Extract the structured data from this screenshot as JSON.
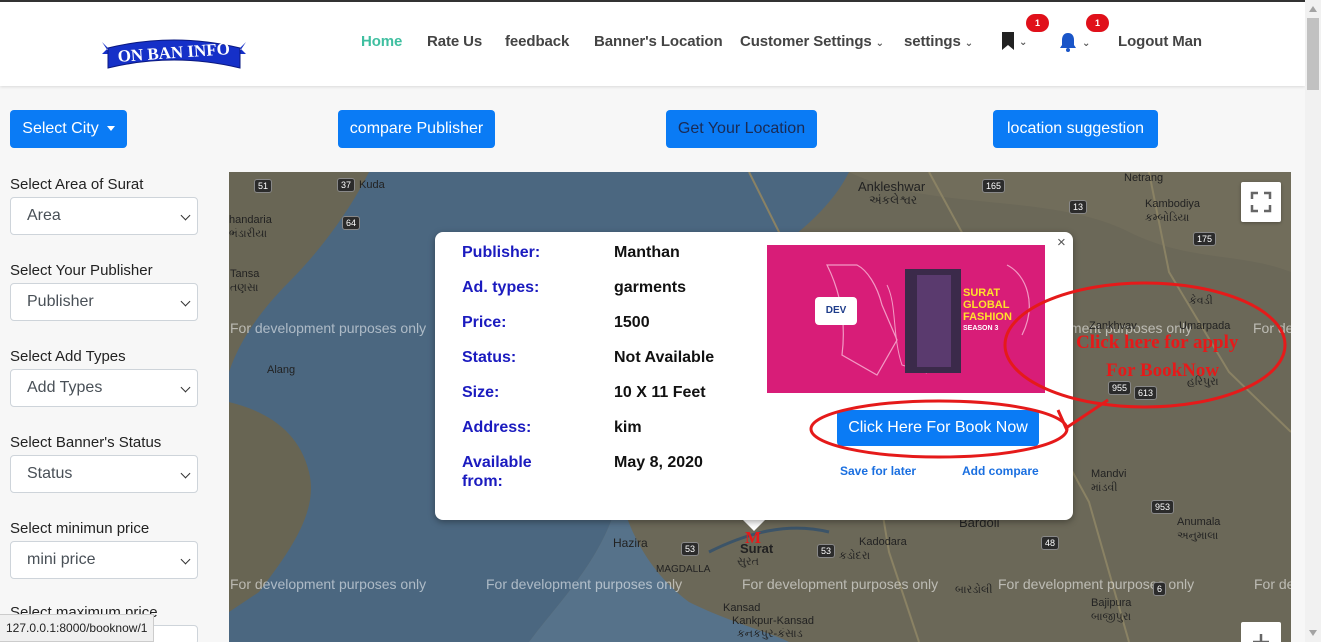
{
  "brand": {
    "logo_text": "ON BAN INFO"
  },
  "nav": {
    "home": "Home",
    "rate_us": "Rate Us",
    "feedback": "feedback",
    "banners_location": "Banner's Location",
    "customer_settings": "Customer Settings",
    "settings": "settings",
    "bookmark_count": "1",
    "notification_count": "1",
    "logout": "Logout Man"
  },
  "actions": {
    "select_city": "Select City",
    "compare_publisher": "compare Publisher",
    "get_location": "Get Your Location",
    "location_suggestion": "location suggestion"
  },
  "sidebar": {
    "area_label": "Select Area of Surat",
    "area_value": "Area",
    "publisher_label": "Select Your Publisher",
    "publisher_value": "Publisher",
    "add_types_label": "Select Add Types",
    "add_types_value": "Add Types",
    "status_label": "Select Banner's Status",
    "status_value": "Status",
    "min_price_label": "Select minimun price",
    "min_price_value": "mini price",
    "max_price_label": "Select maximum price"
  },
  "map": {
    "watermark": "For development purposes only",
    "places": {
      "ankleshwar": "Ankleshwar",
      "ankleshwar_gu": "અંકલેશ્વર",
      "kuda": "Kuda",
      "netrang": "Netrang",
      "kambodiya": "Kambodiya",
      "kambodiya_gu": "કમ્બોડિયા",
      "handaria": "handaria",
      "handaria_gu": "ભંડારીયા",
      "tansa": "Tansa",
      "tansa_gu": "તણસા",
      "alang": "Alang",
      "zankhvav": "Zankhvav",
      "umarpada": "Umarpada",
      "kevdi": "કેવડી",
      "haripura": "હરિપુરા",
      "mandvi": "Mandvi",
      "mandvi_gu": "માંડવી",
      "anumala": "Anumala",
      "anumala_gu": "અનુમાલા",
      "hazira": "Hazira",
      "surat": "Surat",
      "surat_gu": "સુરત",
      "kadodara": "Kadodara",
      "kadodara_gu": "કડોદરા",
      "magdalla": "MAGDALLA",
      "bardoli": "Bardoli",
      "bardoli_gu": "બારડોલી",
      "kansad": "Kansad",
      "kankpur": "Kankpur-Kansad",
      "kankpur_gu": "કનકપુર-કંસાડ",
      "bajipura": "Bajipura",
      "bajipura_gu": "બાજીપુરા"
    },
    "roads": [
      "37",
      "51",
      "165",
      "13",
      "175",
      "64",
      "955",
      "613",
      "53",
      "953",
      "48",
      "6",
      "53"
    ]
  },
  "popup": {
    "publisher_key": "Publisher:",
    "publisher_val": "Manthan",
    "adtypes_key": "Ad. types:",
    "adtypes_val": "garments",
    "price_key": "Price:",
    "price_val": "1500",
    "status_key": "Status:",
    "status_val": "Not Available",
    "size_key": "Size:",
    "size_val": "10 X 11 Feet",
    "address_key": "Address:",
    "address_val": "kim",
    "available_key_1": "Available",
    "available_key_2": "from:",
    "available_val": "May 8, 2020",
    "book_now": "Click Here For Book Now",
    "save_later": "Save for later",
    "add_compare": "Add compare",
    "close": "×",
    "ad": {
      "brand": "DEV",
      "title_1": "SURAT",
      "title_2": "GLOBAL",
      "title_3": "FASHION",
      "season": "SEASON 3"
    }
  },
  "annotation": {
    "line_1": "Click here for apply",
    "line_2": "For BookNow"
  },
  "marker": {
    "label": "M"
  },
  "status_bar": {
    "url": "127.0.0.1:8000/booknow/1"
  },
  "colors": {
    "primary": "#0a7bf5",
    "active_nav": "#3fbfa0",
    "popup_key": "#1b1bbf",
    "annotation": "#e51a1a"
  }
}
